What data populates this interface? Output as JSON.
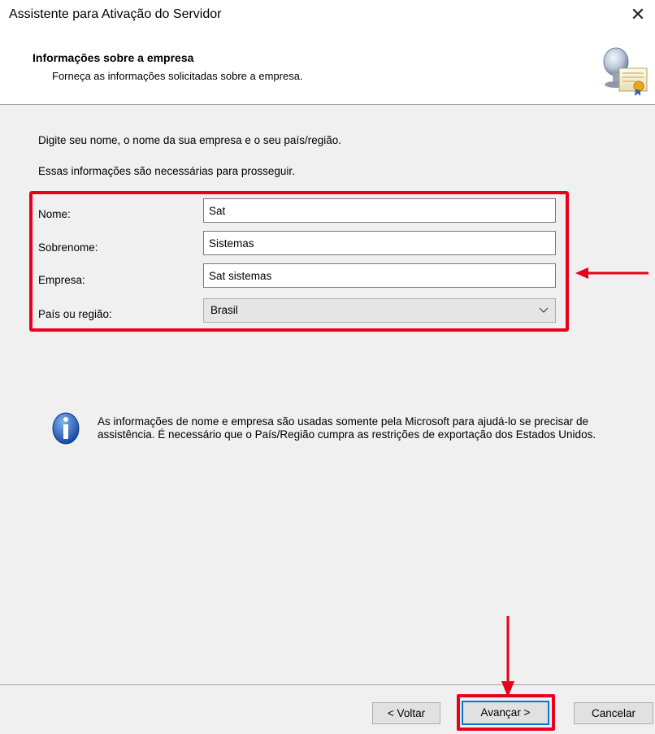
{
  "window": {
    "title": "Assistente para Ativação do Servidor",
    "close_glyph": "✕"
  },
  "header": {
    "title": "Informações sobre a empresa",
    "subtitle": "Forneça as informações solicitadas sobre a empresa.",
    "icon": "server-certificate-icon"
  },
  "content": {
    "intro_line1": "Digite seu nome, o nome da sua empresa e o seu país/região.",
    "intro_line2": "Essas informações são necessárias para prosseguir.",
    "form": {
      "first_name": {
        "label": "Nome:",
        "value": "Sat"
      },
      "last_name": {
        "label": "Sobrenome:",
        "value": "Sistemas"
      },
      "company": {
        "label": "Empresa:",
        "value": "Sat sistemas"
      },
      "country": {
        "label": "País ou região:",
        "value": "Brasil"
      }
    },
    "info": {
      "icon": "info-icon",
      "text": "As informações de nome e empresa são usadas somente pela Microsoft para ajudá-lo se precisar de assistência. É necessário que o País/Região cumpra as restrições de exportação dos Estados Unidos."
    }
  },
  "footer": {
    "back_label": "< Voltar",
    "next_label": "Avançar >",
    "cancel_label": "Cancelar"
  },
  "annotations": {
    "highlight_color": "#e8001c",
    "focus_color": "#0078d7"
  }
}
